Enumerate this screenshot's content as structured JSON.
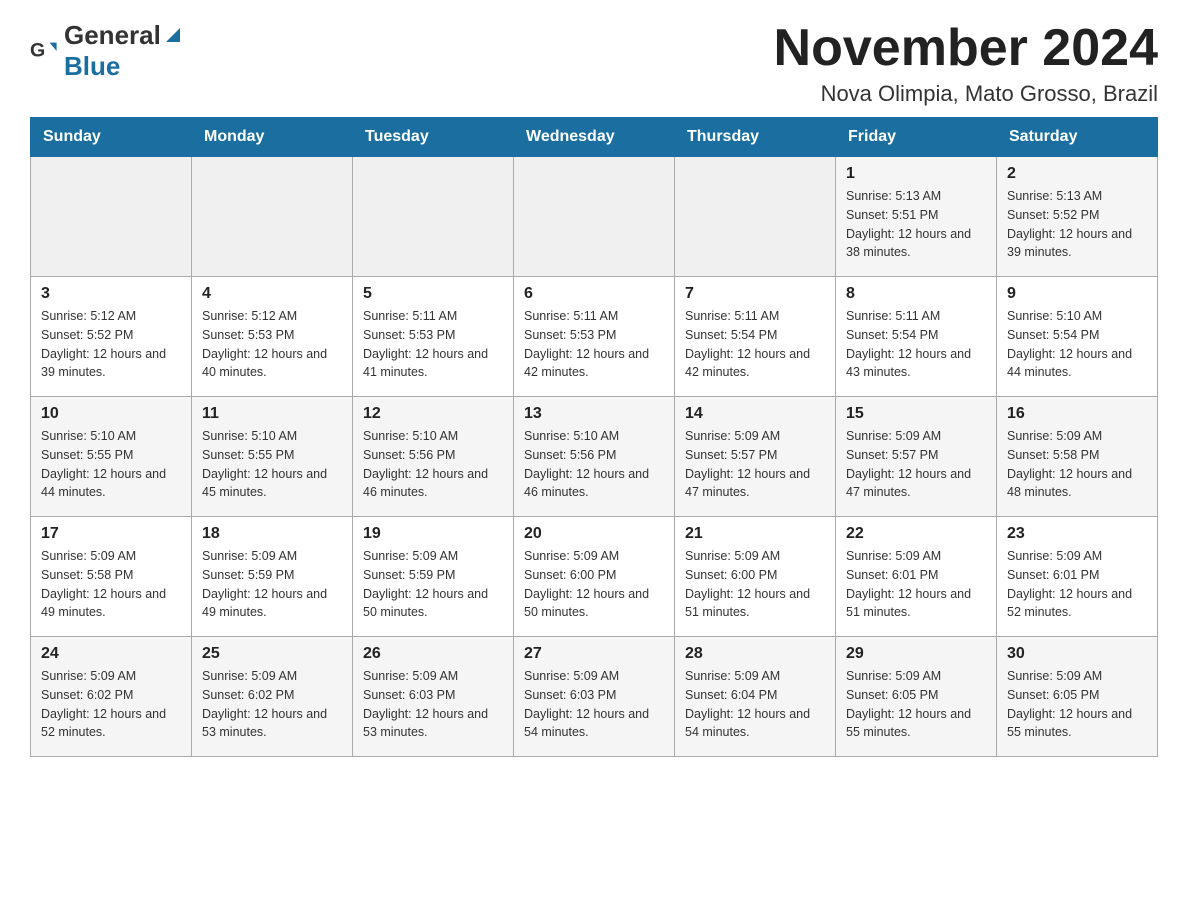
{
  "header": {
    "logo": {
      "text_general": "General",
      "text_blue": "Blue"
    },
    "title": "November 2024",
    "location": "Nova Olimpia, Mato Grosso, Brazil"
  },
  "days_of_week": [
    "Sunday",
    "Monday",
    "Tuesday",
    "Wednesday",
    "Thursday",
    "Friday",
    "Saturday"
  ],
  "weeks": [
    [
      {
        "day": "",
        "sunrise": "",
        "sunset": "",
        "daylight": ""
      },
      {
        "day": "",
        "sunrise": "",
        "sunset": "",
        "daylight": ""
      },
      {
        "day": "",
        "sunrise": "",
        "sunset": "",
        "daylight": ""
      },
      {
        "day": "",
        "sunrise": "",
        "sunset": "",
        "daylight": ""
      },
      {
        "day": "",
        "sunrise": "",
        "sunset": "",
        "daylight": ""
      },
      {
        "day": "1",
        "sunrise": "Sunrise: 5:13 AM",
        "sunset": "Sunset: 5:51 PM",
        "daylight": "Daylight: 12 hours and 38 minutes."
      },
      {
        "day": "2",
        "sunrise": "Sunrise: 5:13 AM",
        "sunset": "Sunset: 5:52 PM",
        "daylight": "Daylight: 12 hours and 39 minutes."
      }
    ],
    [
      {
        "day": "3",
        "sunrise": "Sunrise: 5:12 AM",
        "sunset": "Sunset: 5:52 PM",
        "daylight": "Daylight: 12 hours and 39 minutes."
      },
      {
        "day": "4",
        "sunrise": "Sunrise: 5:12 AM",
        "sunset": "Sunset: 5:53 PM",
        "daylight": "Daylight: 12 hours and 40 minutes."
      },
      {
        "day": "5",
        "sunrise": "Sunrise: 5:11 AM",
        "sunset": "Sunset: 5:53 PM",
        "daylight": "Daylight: 12 hours and 41 minutes."
      },
      {
        "day": "6",
        "sunrise": "Sunrise: 5:11 AM",
        "sunset": "Sunset: 5:53 PM",
        "daylight": "Daylight: 12 hours and 42 minutes."
      },
      {
        "day": "7",
        "sunrise": "Sunrise: 5:11 AM",
        "sunset": "Sunset: 5:54 PM",
        "daylight": "Daylight: 12 hours and 42 minutes."
      },
      {
        "day": "8",
        "sunrise": "Sunrise: 5:11 AM",
        "sunset": "Sunset: 5:54 PM",
        "daylight": "Daylight: 12 hours and 43 minutes."
      },
      {
        "day": "9",
        "sunrise": "Sunrise: 5:10 AM",
        "sunset": "Sunset: 5:54 PM",
        "daylight": "Daylight: 12 hours and 44 minutes."
      }
    ],
    [
      {
        "day": "10",
        "sunrise": "Sunrise: 5:10 AM",
        "sunset": "Sunset: 5:55 PM",
        "daylight": "Daylight: 12 hours and 44 minutes."
      },
      {
        "day": "11",
        "sunrise": "Sunrise: 5:10 AM",
        "sunset": "Sunset: 5:55 PM",
        "daylight": "Daylight: 12 hours and 45 minutes."
      },
      {
        "day": "12",
        "sunrise": "Sunrise: 5:10 AM",
        "sunset": "Sunset: 5:56 PM",
        "daylight": "Daylight: 12 hours and 46 minutes."
      },
      {
        "day": "13",
        "sunrise": "Sunrise: 5:10 AM",
        "sunset": "Sunset: 5:56 PM",
        "daylight": "Daylight: 12 hours and 46 minutes."
      },
      {
        "day": "14",
        "sunrise": "Sunrise: 5:09 AM",
        "sunset": "Sunset: 5:57 PM",
        "daylight": "Daylight: 12 hours and 47 minutes."
      },
      {
        "day": "15",
        "sunrise": "Sunrise: 5:09 AM",
        "sunset": "Sunset: 5:57 PM",
        "daylight": "Daylight: 12 hours and 47 minutes."
      },
      {
        "day": "16",
        "sunrise": "Sunrise: 5:09 AM",
        "sunset": "Sunset: 5:58 PM",
        "daylight": "Daylight: 12 hours and 48 minutes."
      }
    ],
    [
      {
        "day": "17",
        "sunrise": "Sunrise: 5:09 AM",
        "sunset": "Sunset: 5:58 PM",
        "daylight": "Daylight: 12 hours and 49 minutes."
      },
      {
        "day": "18",
        "sunrise": "Sunrise: 5:09 AM",
        "sunset": "Sunset: 5:59 PM",
        "daylight": "Daylight: 12 hours and 49 minutes."
      },
      {
        "day": "19",
        "sunrise": "Sunrise: 5:09 AM",
        "sunset": "Sunset: 5:59 PM",
        "daylight": "Daylight: 12 hours and 50 minutes."
      },
      {
        "day": "20",
        "sunrise": "Sunrise: 5:09 AM",
        "sunset": "Sunset: 6:00 PM",
        "daylight": "Daylight: 12 hours and 50 minutes."
      },
      {
        "day": "21",
        "sunrise": "Sunrise: 5:09 AM",
        "sunset": "Sunset: 6:00 PM",
        "daylight": "Daylight: 12 hours and 51 minutes."
      },
      {
        "day": "22",
        "sunrise": "Sunrise: 5:09 AM",
        "sunset": "Sunset: 6:01 PM",
        "daylight": "Daylight: 12 hours and 51 minutes."
      },
      {
        "day": "23",
        "sunrise": "Sunrise: 5:09 AM",
        "sunset": "Sunset: 6:01 PM",
        "daylight": "Daylight: 12 hours and 52 minutes."
      }
    ],
    [
      {
        "day": "24",
        "sunrise": "Sunrise: 5:09 AM",
        "sunset": "Sunset: 6:02 PM",
        "daylight": "Daylight: 12 hours and 52 minutes."
      },
      {
        "day": "25",
        "sunrise": "Sunrise: 5:09 AM",
        "sunset": "Sunset: 6:02 PM",
        "daylight": "Daylight: 12 hours and 53 minutes."
      },
      {
        "day": "26",
        "sunrise": "Sunrise: 5:09 AM",
        "sunset": "Sunset: 6:03 PM",
        "daylight": "Daylight: 12 hours and 53 minutes."
      },
      {
        "day": "27",
        "sunrise": "Sunrise: 5:09 AM",
        "sunset": "Sunset: 6:03 PM",
        "daylight": "Daylight: 12 hours and 54 minutes."
      },
      {
        "day": "28",
        "sunrise": "Sunrise: 5:09 AM",
        "sunset": "Sunset: 6:04 PM",
        "daylight": "Daylight: 12 hours and 54 minutes."
      },
      {
        "day": "29",
        "sunrise": "Sunrise: 5:09 AM",
        "sunset": "Sunset: 6:05 PM",
        "daylight": "Daylight: 12 hours and 55 minutes."
      },
      {
        "day": "30",
        "sunrise": "Sunrise: 5:09 AM",
        "sunset": "Sunset: 6:05 PM",
        "daylight": "Daylight: 12 hours and 55 minutes."
      }
    ]
  ]
}
